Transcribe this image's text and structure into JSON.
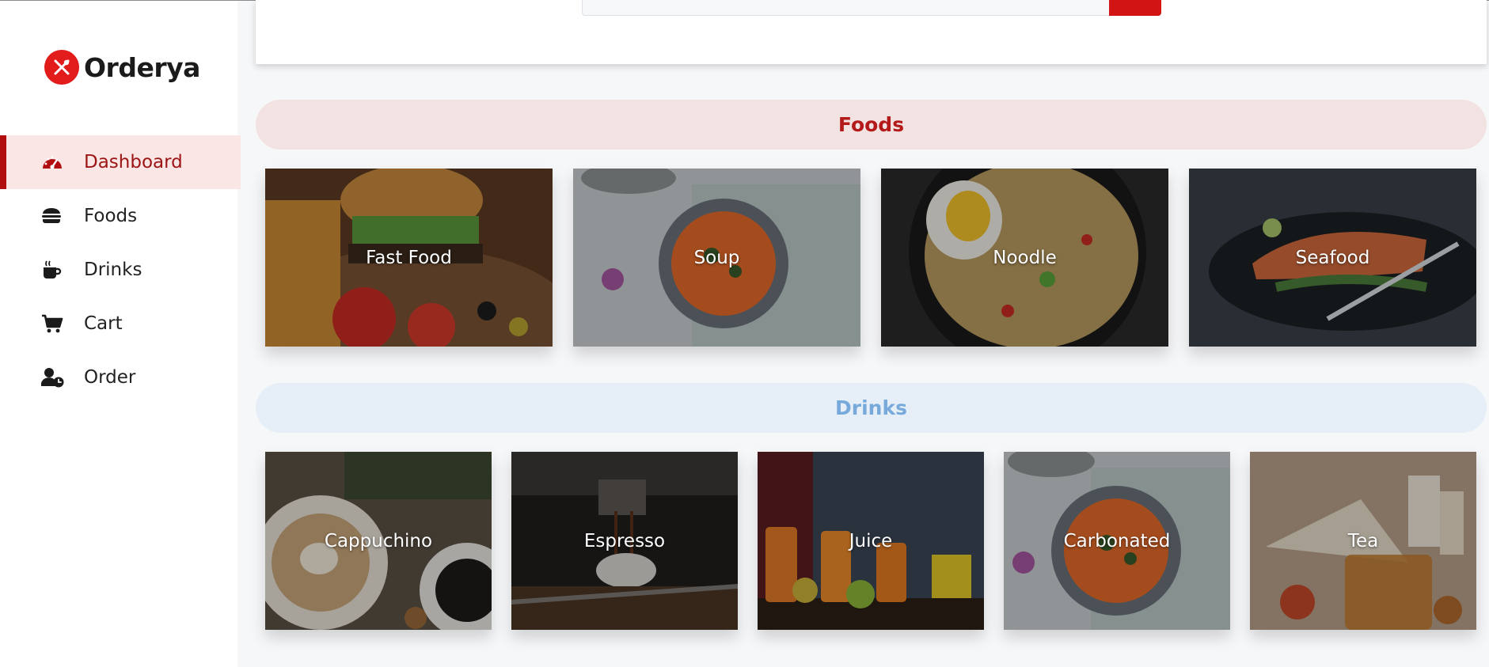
{
  "app": {
    "brand_name": "Orderya",
    "brand_color": "#e21b1b"
  },
  "sidebar": {
    "items": [
      {
        "label": "Dashboard",
        "icon": "gauge-icon",
        "active": true
      },
      {
        "label": "Foods",
        "icon": "burger-icon",
        "active": false
      },
      {
        "label": "Drinks",
        "icon": "coffee-cup-icon",
        "active": false
      },
      {
        "label": "Cart",
        "icon": "cart-icon",
        "active": false
      },
      {
        "label": "Order",
        "icon": "user-clock-icon",
        "active": false
      }
    ]
  },
  "sections": {
    "foods": {
      "title": "Foods",
      "items": [
        "Fast Food",
        "Soup",
        "Noodle",
        "Seafood"
      ]
    },
    "drinks": {
      "title": "Drinks",
      "items": [
        "Cappuchino",
        "Espresso",
        "Juice",
        "Carbonated",
        "Tea"
      ]
    }
  },
  "colors": {
    "active_accent": "#b10f0f",
    "foods_header": "#b51a1a",
    "drinks_header": "#77aadb"
  }
}
